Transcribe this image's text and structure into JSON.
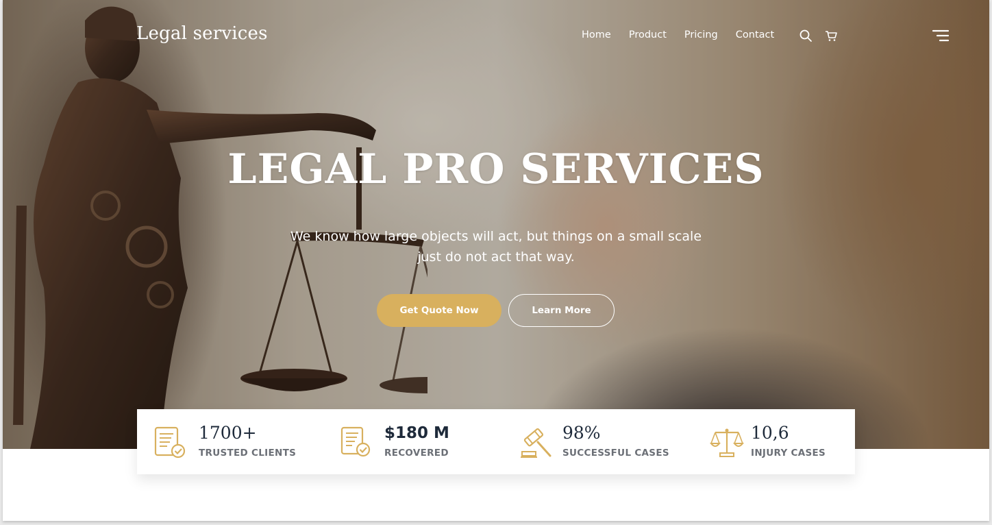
{
  "brand": {
    "name": "Legal services"
  },
  "nav": {
    "links": [
      {
        "label": "Home"
      },
      {
        "label": "Product"
      },
      {
        "label": "Pricing"
      },
      {
        "label": "Contact"
      }
    ],
    "icons": [
      "search-icon",
      "cart-icon",
      "menu-icon"
    ]
  },
  "hero": {
    "title": "LEGAL PRO SERVICES",
    "subtitle": "We know how large objects will act, but things on a small scale just do not act that way.",
    "primary_button": "Get Quote Now",
    "secondary_button": "Learn More"
  },
  "stats": [
    {
      "value": "1700+",
      "label": "TRUSTED CLIENTS",
      "icon": "certificate-icon"
    },
    {
      "value": "$180 M",
      "label": "RECOVERED",
      "icon": "document-check-icon"
    },
    {
      "value": "98%",
      "label": "SUCCESSFUL CASES",
      "icon": "gavel-icon"
    },
    {
      "value": "10,6",
      "label": "INJURY CASES",
      "icon": "scales-icon"
    }
  ],
  "colors": {
    "accent": "#d8b05e",
    "heading_dark": "#1e2a3a",
    "label_gray": "#6b6f76",
    "white": "#ffffff"
  }
}
